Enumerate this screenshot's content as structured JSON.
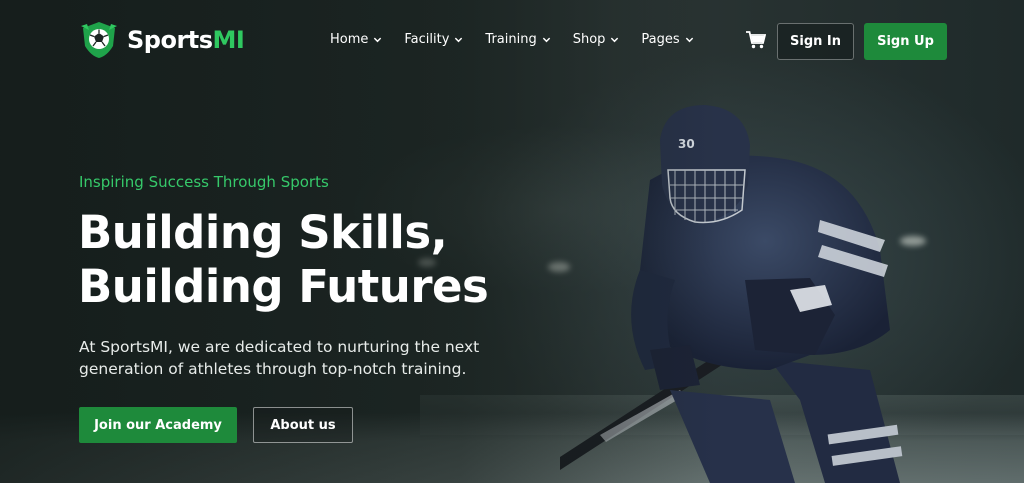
{
  "brand": {
    "name_main": "Sports",
    "name_accent": "MI",
    "logo_icon": "soccer-ball-shield-icon",
    "accent_color": "#2fc860"
  },
  "nav": {
    "items": [
      {
        "label": "Home",
        "icon": "chevron-down-icon"
      },
      {
        "label": "Facility",
        "icon": "chevron-down-icon"
      },
      {
        "label": "Training",
        "icon": "chevron-down-icon"
      },
      {
        "label": "Shop",
        "icon": "chevron-down-icon"
      },
      {
        "label": "Pages",
        "icon": "chevron-down-icon"
      }
    ],
    "cart_icon": "cart-icon",
    "sign_in_label": "Sign In",
    "sign_up_label": "Sign Up"
  },
  "hero": {
    "eyebrow": "Inspiring Success Through Sports",
    "headline_line1": "Building Skills,",
    "headline_line2": "Building Futures",
    "description_line1": "At SportsMI, we are dedicated to nurturing the next",
    "description_line2": "generation of athletes through top-notch training.",
    "primary_cta": "Join our Academy",
    "secondary_cta": "About us",
    "image_subject": "ice-hockey-player",
    "jersey_number": "30",
    "primary_color": "#1e8a3b"
  }
}
